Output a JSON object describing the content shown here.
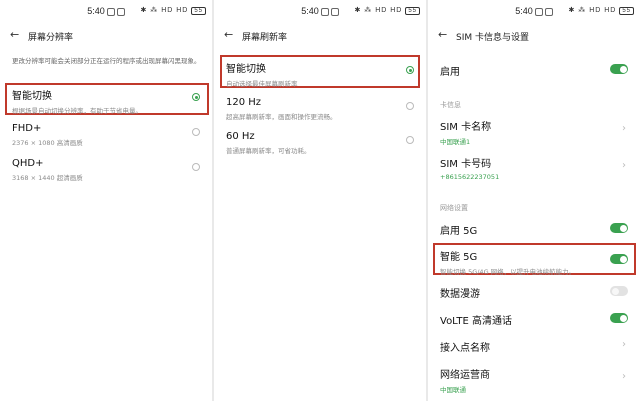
{
  "status": {
    "time": "5:40",
    "icons": "✱ ⁂ HD HD",
    "battery": "55"
  },
  "panel1": {
    "title": "屏幕分辨率",
    "note": "更改分辨率可能会关闭部分正在运行的程序或出现屏幕闪黑现象。",
    "options": [
      {
        "label": "智能切换",
        "sub": "根据场景自动切换分辨率，有助于节省电量。",
        "selected": true
      },
      {
        "label": "FHD+",
        "sub": "2376 × 1080 高清画质",
        "selected": false
      },
      {
        "label": "QHD+",
        "sub": "3168 × 1440 超清画质",
        "selected": false
      }
    ]
  },
  "panel2": {
    "title": "屏幕刷新率",
    "options": [
      {
        "label": "智能切换",
        "sub": "自动选择最佳屏幕刷新率",
        "selected": true
      },
      {
        "label": "120 Hz",
        "sub": "超高屏幕刷新率，画面和操作更流畅。",
        "selected": false
      },
      {
        "label": "60 Hz",
        "sub": "普通屏幕刷新率，可省功耗。",
        "selected": false
      }
    ]
  },
  "panel3": {
    "title": "SIM 卡信息与设置",
    "enable_label": "启用",
    "section_card": "卡信息",
    "sim_name_label": "SIM 卡名称",
    "sim_name_value": "中国联通1",
    "sim_number_label": "SIM 卡号码",
    "sim_number_value": "+8615622237051",
    "section_network": "网络设置",
    "enable5g_label": "启用 5G",
    "smart5g_label": "智能 5G",
    "smart5g_sub": "智能切换 5G/4G 网络，以提升电池续航能力。",
    "roaming_label": "数据漫游",
    "volte_label": "VoLTE 高清通话",
    "apn_label": "接入点名称",
    "carrier_label": "网络运营商",
    "carrier_value": "中国联通"
  }
}
